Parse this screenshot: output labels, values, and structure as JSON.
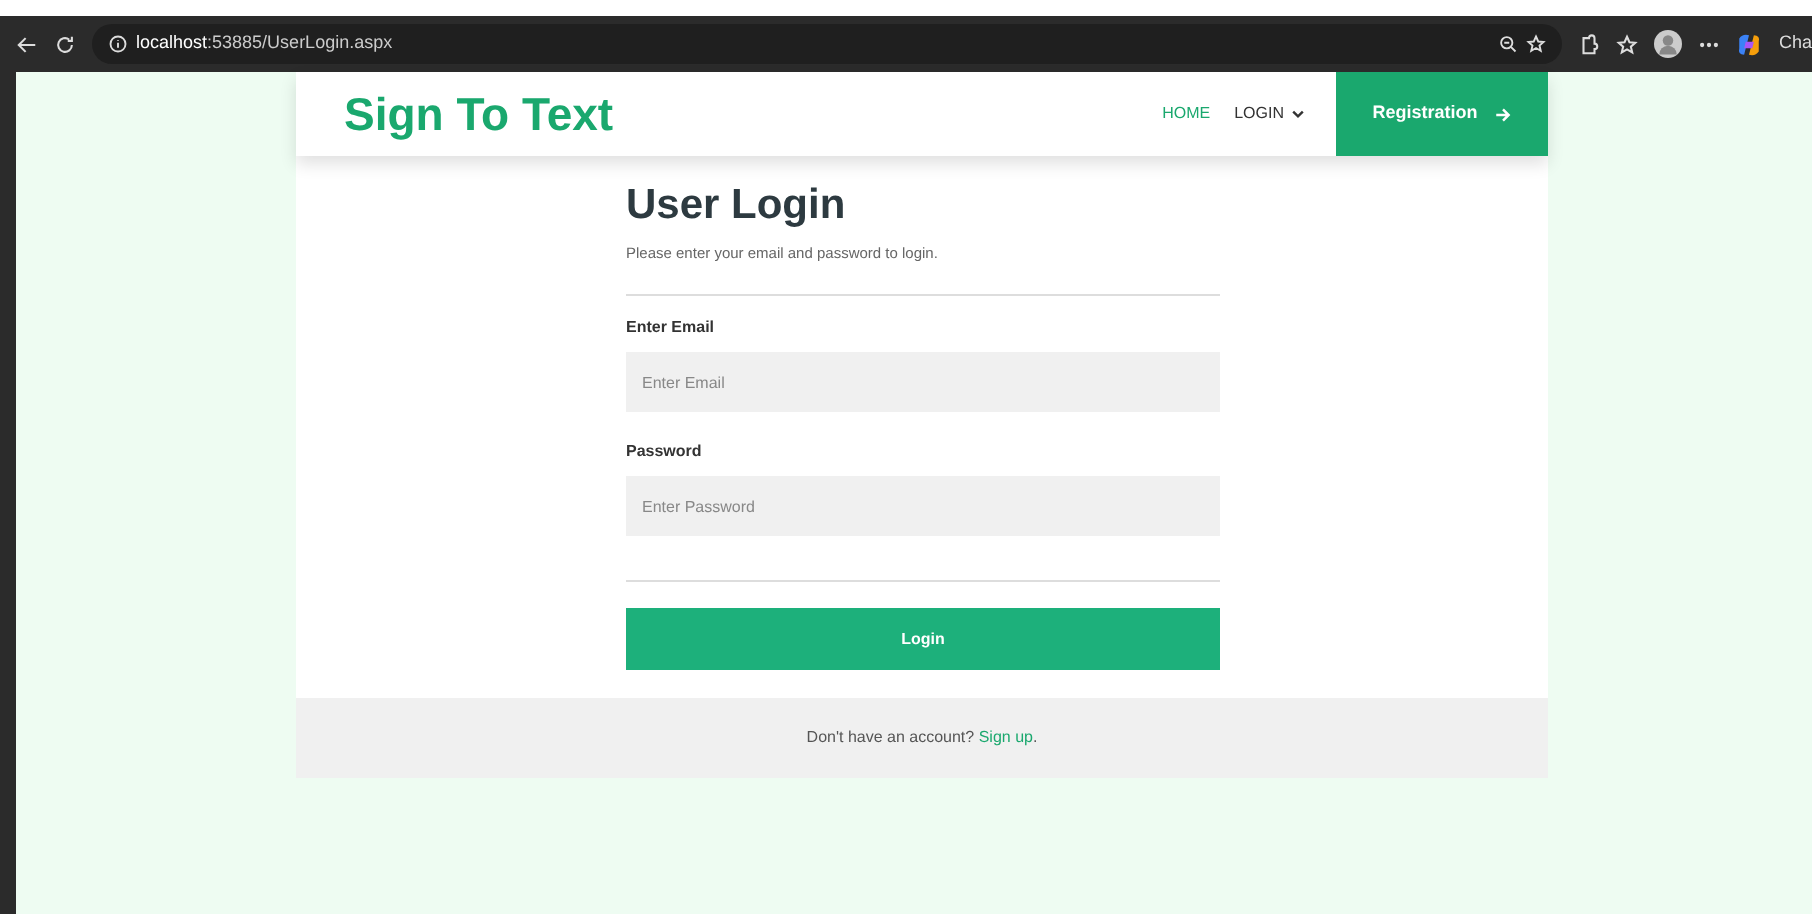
{
  "browser": {
    "address": "localhost:53885/UserLogin.aspx",
    "copilot_label": "Cha"
  },
  "navbar": {
    "brand": "Sign To Text",
    "links": [
      {
        "label": "HOME",
        "selected": true,
        "kind": "link"
      },
      {
        "label": "LOGIN",
        "selected": false,
        "kind": "dropdown"
      }
    ],
    "cta": "Registration"
  },
  "form": {
    "title": "User Login",
    "subtitle": "Please enter your email and password to login.",
    "fields": [
      {
        "label": "Enter Email",
        "placeholder": "Enter Email"
      },
      {
        "label": "Password",
        "placeholder": "Enter Password"
      }
    ],
    "submit": "Login"
  },
  "footer": {
    "text": "Don't have an account?",
    "link": "Sign up",
    "after": "."
  }
}
